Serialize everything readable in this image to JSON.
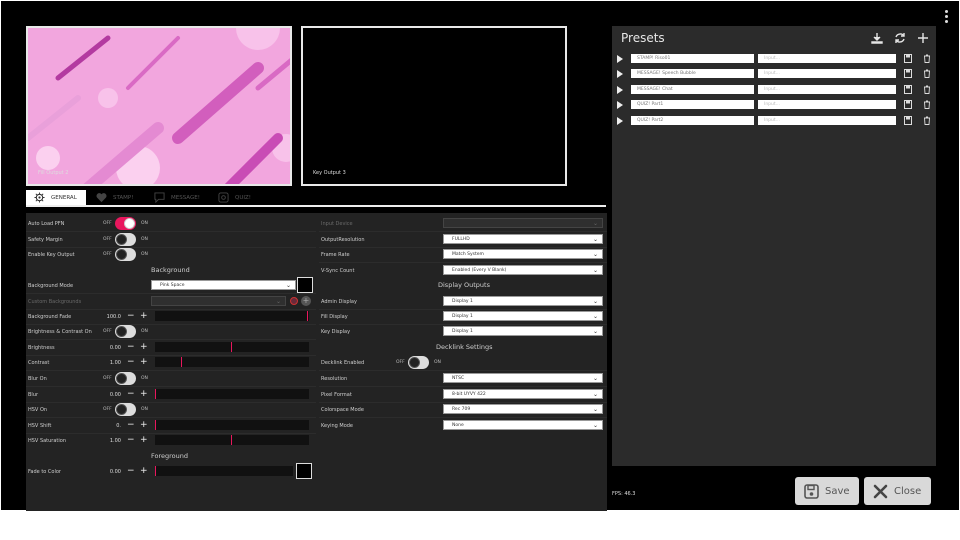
{
  "previews": {
    "output1_label": "Fill Output 2",
    "output2_label": "Key Output 3"
  },
  "tabs": [
    {
      "label": "GENERAL",
      "icon": "gear-icon",
      "active": true
    },
    {
      "label": "STAMP!",
      "icon": "heart-icon",
      "active": false
    },
    {
      "label": "MESSAGE!",
      "icon": "chat-bubble-icon",
      "active": false
    },
    {
      "label": "QUIZ!",
      "icon": "quiz-icon",
      "active": false
    }
  ],
  "general": {
    "auto_load_pfn": {
      "label": "Auto Load PFN",
      "off": "OFF",
      "on": "ON",
      "state": true
    },
    "safety_margin": {
      "label": "Safety Margin",
      "off": "OFF",
      "on": "ON",
      "state": false
    },
    "enable_key_output": {
      "label": "Enable Key Output",
      "off": "OFF",
      "on": "ON",
      "state": false
    }
  },
  "background": {
    "title": "Background",
    "mode": {
      "label": "Background Mode",
      "value": "Pink Space"
    },
    "custom": {
      "label": "Custom Backgrounds",
      "value": ""
    },
    "fade": {
      "label": "Background Fade",
      "value": "100.0",
      "level": 1.0
    },
    "bc_on": {
      "label": "Brightness & Contrast On",
      "off": "OFF",
      "on": "ON",
      "state": false
    },
    "brightness": {
      "label": "Brightness",
      "value": "0.00",
      "level": 0.5
    },
    "contrast": {
      "label": "Contrast",
      "value": "1.00",
      "level": 0.17
    },
    "blur_on": {
      "label": "Blur On",
      "off": "OFF",
      "on": "ON",
      "state": false
    },
    "blur": {
      "label": "Blur",
      "value": "0.00",
      "level": 0.0
    },
    "hsv_on": {
      "label": "HSV On",
      "off": "OFF",
      "on": "ON",
      "state": false
    },
    "hsv_shift": {
      "label": "HSV Shift",
      "value": "0.",
      "level": 0.0
    },
    "hsv_saturation": {
      "label": "HSV Saturation",
      "value": "1.00",
      "level": 0.5
    }
  },
  "foreground": {
    "title": "Foreground",
    "fade_to_color": {
      "label": "Fade to Color",
      "value": "0.00",
      "level": 0.0
    }
  },
  "output": {
    "input_device": {
      "label": "Input Device",
      "value": ""
    },
    "resolution": {
      "label": "OutputResolution",
      "value": "FULLHD"
    },
    "frame_rate": {
      "label": "Frame Rate",
      "value": "Match System"
    },
    "vsync": {
      "label": "V-Sync Count",
      "value": "Enabled (Every V Blank)"
    }
  },
  "display_outputs": {
    "title": "Display Outputs",
    "admin": {
      "label": "Admin Display",
      "value": "Display 1"
    },
    "fill": {
      "label": "Fill Display",
      "value": "Display 1"
    },
    "key": {
      "label": "Key Display",
      "value": "Display 1"
    }
  },
  "decklink": {
    "title": "Decklink Settings",
    "enabled": {
      "label": "Decklink Enabled",
      "off": "OFF",
      "on": "ON",
      "state": false
    },
    "resolution": {
      "label": "Resolution",
      "value": "NTSC"
    },
    "pixel_format": {
      "label": "Pixel Format",
      "value": "8-bit UYVY 422"
    },
    "colorspace": {
      "label": "Colorspace Mode",
      "value": "Rec 709"
    },
    "keying": {
      "label": "Keying Mode",
      "value": "None"
    }
  },
  "presets": {
    "title": "Presets",
    "items": [
      {
        "name": "STAMP! Riso01",
        "input": "Input..."
      },
      {
        "name": "MESSAGE! Speech Bubble",
        "input": "Input..."
      },
      {
        "name": "MESSAGE! Chat",
        "input": "Input..."
      },
      {
        "name": "QUIZ! Part1",
        "input": "Input..."
      },
      {
        "name": "QUIZ! Part2",
        "input": "Input..."
      }
    ]
  },
  "footer": {
    "fps": "FPS: 46.3",
    "save_label": "Save",
    "close_label": "Close"
  },
  "colors": {
    "accent": "#e8175d",
    "panel": "#232323",
    "preview_bg": "#f2a6de"
  }
}
